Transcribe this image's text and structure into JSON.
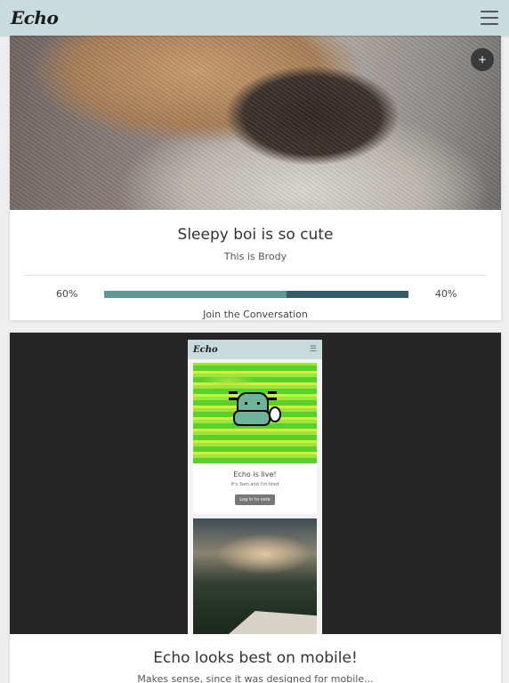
{
  "nav": {
    "brand": "Echo",
    "menu_icon": "hamburger-icon"
  },
  "posts": [
    {
      "add_icon_label": "+",
      "title": "Sleepy boi is so cute",
      "subtitle": "This is  Brody",
      "vote": {
        "left_percent": "60%",
        "right_percent": "40%",
        "left_fraction": 0.6,
        "right_fraction": 0.4
      },
      "join_label": "Join the Conversation"
    },
    {
      "preview": {
        "brand": "Echo",
        "menu_glyph": "☰",
        "card_title": "Echo is live!",
        "card_subtitle": "It's 3am and  I'm tired",
        "button_label": "Log in to vote"
      },
      "title": "Echo looks best on mobile!",
      "subtitle": "Makes sense, since it was designed for mobile..."
    }
  ],
  "colors": {
    "navbar": "#c8dcdd",
    "bar_left": "#5e9696",
    "bar_right": "#345b6a",
    "preview_bg": "#262626"
  }
}
